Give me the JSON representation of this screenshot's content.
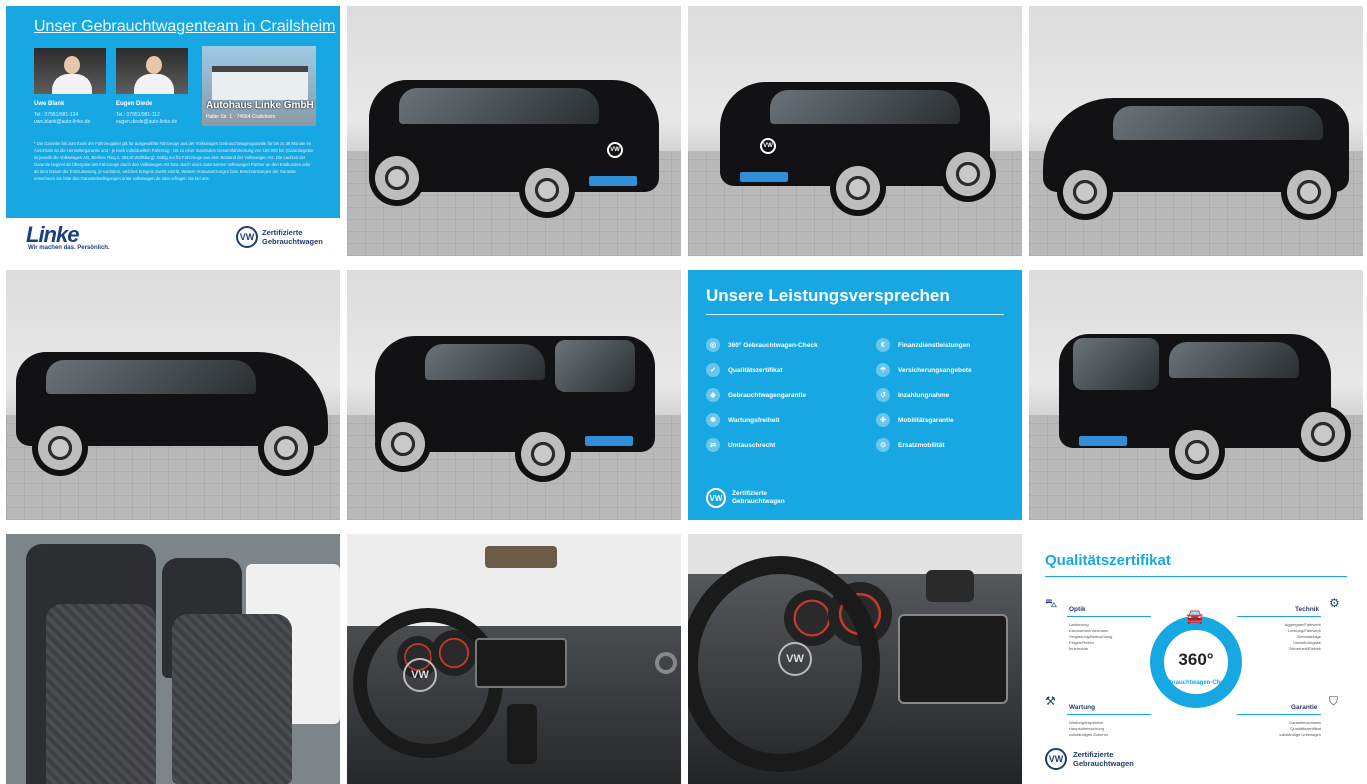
{
  "team": {
    "title": "Unser Gebrauchtwagenteam in Crailsheim",
    "person1_name": "Uwe Blank",
    "person1_info": "Tel.: 07951/981-134\nuwe.blank@auto-linke.de",
    "person2_name": "Eugen Diede",
    "person2_info": "Tel.: 07951/981-112\neugen.diede@auto-linke.de",
    "dealer_name": "Autohaus Linke GmbH",
    "dealer_address": "Haller Str. 1 · 74564 Crailsheim",
    "fine_print": "* Die Garantie bis zum Ende der Fahrzeugalter gilt für ausgewählte Fahrzeuge aus der Volkswagen Gebrauchtwagengarantie für bis zu 36 Monate im Anschluss an die Herstellergarantie und - je nach individuellem Fahrzeug - bis zu einer maximalen Gesamtfahrleistung von 150.000 km (Garantiegeber ist jeweils die Volkswagen AG, Berliner Ring 2, 38440 Wolfsburg). Gültig nur für Fahrzeuge aus dem Bestand der Volkswagen AG. Die Laufzeit der Garantie beginnt ab Übergabe des Fahrzeugs durch den Volkswagen AG bzw. durch einen autorisierten Volkswagen Partner an den Endkunden oder ab dem Datum der Erstzulassung, je nachdem, welches Ereignis zuerst eintritt. Weitere Voraussetzungen bzw. Beschränkungen der Garantie entnehmen Sie bitte den Garantiebedingungen unter volkswagen.de oder erfragen Sie bei uns.",
    "logo": "Linke",
    "logo_tagline": "Wir machen das. Persönlich.",
    "cert_line1": "Zertifizierte",
    "cert_line2": "Gebrauchtwagen"
  },
  "promises": {
    "title": "Unsere Leistungsversprechen",
    "left_items": [
      "360° Gebrauchtwagen-Check",
      "Qualitätszertifikat",
      "Gebrauchtwagengarantie",
      "Wartungsfreiheit",
      "Umtauschrecht"
    ],
    "right_items": [
      "Finanzdienstleistungen",
      "Versicherungsangebote",
      "Inzahlungnahme",
      "Mobilitätsgarantie",
      "Ersatzmobilität"
    ],
    "cert_line1": "Zertifizierte",
    "cert_line2": "Gebrauchtwagen"
  },
  "certificate": {
    "title": "Qualitätszertifikat",
    "badge_number": "360°",
    "badge_text": "Gebrauchtwagen-Check",
    "optik": {
      "heading": "Optik",
      "items": [
        "Lackierung",
        "Karosserie/Innenraum",
        "Verglasung/Beleuchtung",
        "Felgen/Reifen",
        "Innenraum"
      ]
    },
    "technik": {
      "heading": "Technik",
      "items": [
        "Aggregate/Fahrwerk",
        "Lenkung/Fahrwerk",
        "Bremsanlage",
        "Umwelt/Abgase",
        "Sicherheit/Elektrik"
      ]
    },
    "wartung": {
      "heading": "Wartung",
      "items": [
        "Wartung/Inspektion",
        "Hauptuntersuchung",
        "vollständiges Zubehör"
      ]
    },
    "garantie": {
      "heading": "Garantie",
      "items": [
        "Garantienachweis",
        "Qualitätszertifikat",
        "vollständige Unterlagen"
      ]
    },
    "cert_line1": "Zertifizierte",
    "cert_line2": "Gebrauchtwagen"
  },
  "vw_mark": "VW",
  "colors": {
    "accent": "#17a8e3",
    "dark_blue": "#233d6e",
    "car_body": "#121214"
  }
}
